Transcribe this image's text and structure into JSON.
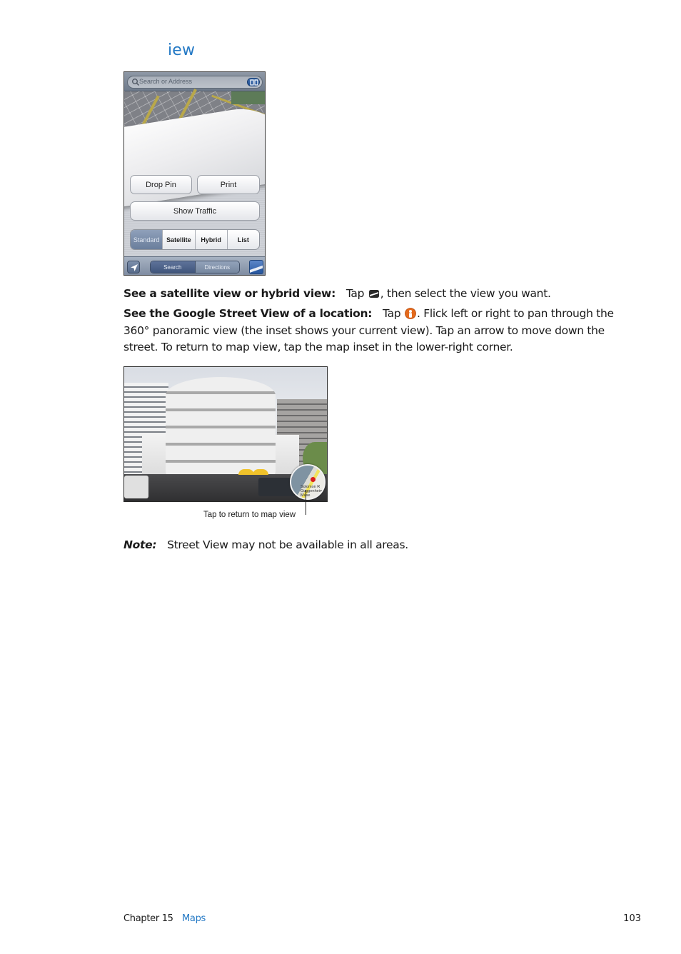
{
  "heading": "iew",
  "phone_screenshot": {
    "search_placeholder": "Search or Address",
    "buttons": {
      "drop_pin": "Drop Pin",
      "print": "Print",
      "show_traffic": "Show Traffic"
    },
    "view_modes": [
      {
        "label": "Standard",
        "active": true
      },
      {
        "label": "Satellite",
        "active": false
      },
      {
        "label": "Hybrid",
        "active": false
      },
      {
        "label": "List",
        "active": false
      }
    ],
    "toolbar": {
      "search": "Search",
      "directions": "Directions"
    },
    "colors": {
      "toolbar": "#7c8aa0",
      "active_segment": "#6a7e9c"
    }
  },
  "paragraphs": {
    "satellite": {
      "bold": "See a satellite view or hybrid view:",
      "before_icon": "Tap",
      "after_icon": ", then select the view you want.",
      "icon": "page-curl-icon"
    },
    "street_view": {
      "bold": "See the Google Street View of a location:",
      "before_icon": "Tap",
      "after_icon": ". Flick left or right to pan through the 360° panoramic view (the inset shows your current view). Tap an arrow to move down the street. To return to map view, tap the map inset in the lower-right corner.",
      "icon": "street-view-icon"
    }
  },
  "street_view_image": {
    "inset_label": "Solomon R Guggenheim Muse",
    "callout": "Tap to return to map view"
  },
  "note": {
    "label": "Note:",
    "text": "Street View may not be available in all areas."
  },
  "footer": {
    "chapter": "Chapter 15",
    "section": "Maps",
    "page": "103"
  },
  "colors": {
    "accent": "#2479c5",
    "text": "#1a1a1a"
  }
}
